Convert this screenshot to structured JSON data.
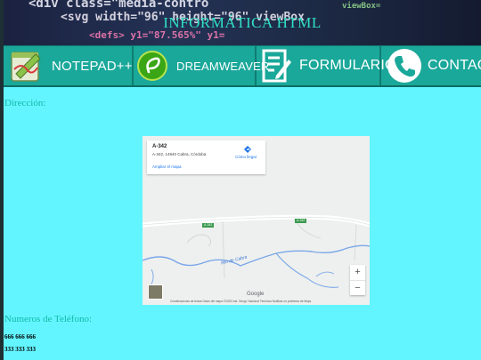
{
  "banner": {
    "title": "INFORMÁTICA HTML",
    "code_lines": [
      "<div class=\"media-contro",
      "<svg width=\"96\" height=\"96\" viewBox",
      "<defs>     y1=\"87.565%\" y1=",
      "viewBox="
    ]
  },
  "nav": {
    "items": [
      {
        "label": "NOTEPAD++",
        "icon": "notepad-icon"
      },
      {
        "label": "DREAMWEAVER",
        "icon": "dreamweaver-icon"
      },
      {
        "label": "FORMULARIO",
        "icon": "form-icon"
      },
      {
        "label": "CONTACT",
        "icon": "phone-icon"
      }
    ]
  },
  "content": {
    "address_label": "Dirección:",
    "phones_label": "Numeros de Teléfono:",
    "phones": [
      "666 666 666",
      "333 333 333"
    ]
  },
  "map": {
    "place_name": "A-342",
    "place_address": "A-342, 14940 Cabra, Córdoba",
    "directions_label": "Cómo llegar",
    "enlarge_label": "Ampliar el mapa",
    "river_label": "Río de Cabra",
    "road_labels": [
      "A-342",
      "A-342"
    ],
    "zoom_in": "+",
    "zoom_out": "−",
    "google_logo": "Google",
    "attribution": "Combinaciones de teclas    Datos del mapa ©2023 Inst. Geogr. Nacional    Términos    Notificar un problema de Maps",
    "colors": {
      "water": "#7aa7e8",
      "road": "#ffffff",
      "land": "#eef0ef"
    }
  },
  "colors": {
    "page_bg": "#63f5ff",
    "nav_bg": "#1aa89a",
    "label_teal": "#12b9a8",
    "banner_title": "#2fe0c4"
  }
}
